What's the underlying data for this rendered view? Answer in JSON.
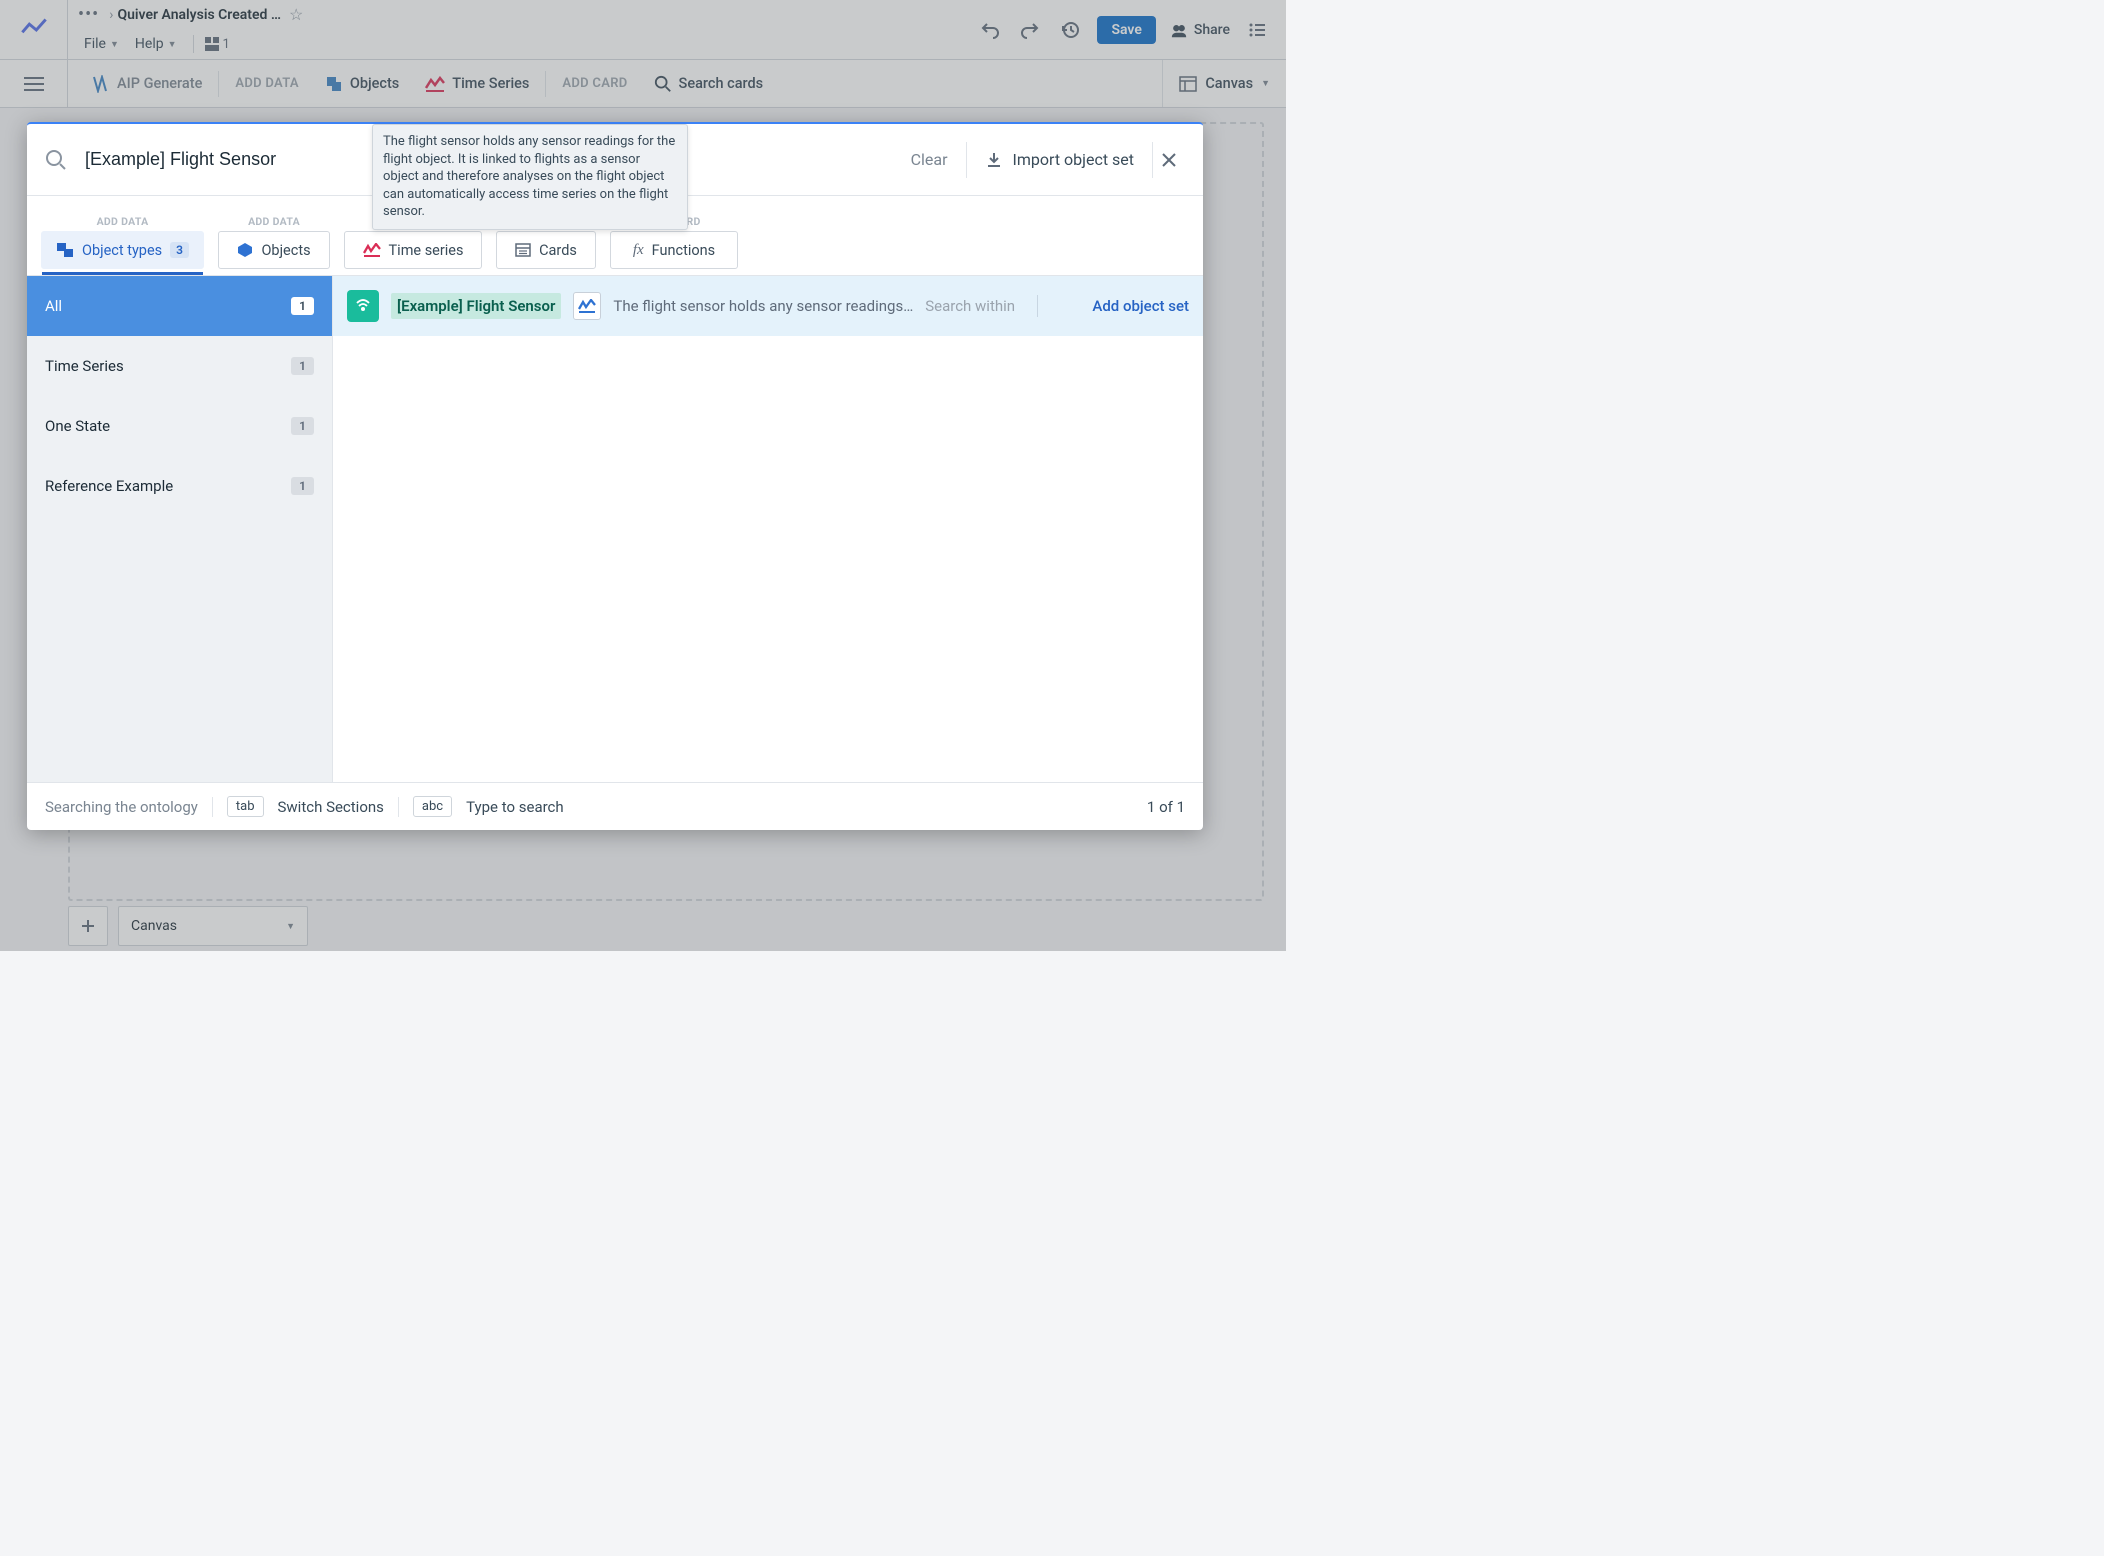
{
  "header": {
    "breadcrumb_title": "Quiver Analysis Created …",
    "file_label": "File",
    "help_label": "Help",
    "dash_count": "1",
    "save_label": "Save",
    "share_label": "Share"
  },
  "toolbar": {
    "aip_generate": "AIP Generate",
    "add_data": "ADD DATA",
    "objects": "Objects",
    "time_series": "Time Series",
    "add_card": "ADD CARD",
    "search_cards": "Search cards",
    "canvas": "Canvas"
  },
  "bottom": {
    "canvas_label": "Canvas"
  },
  "modal": {
    "search_value": "[Example] Flight Sensor",
    "clear": "Clear",
    "import": "Import object set"
  },
  "tabs": {
    "caption_add_data": "ADD DATA",
    "caption_add_card": "ADD CARD",
    "object_types": "Object types",
    "object_types_count": "3",
    "objects": "Objects",
    "time_series": "Time series",
    "cards": "Cards",
    "functions": "Functions"
  },
  "sidebar": [
    {
      "label": "All",
      "count": "1"
    },
    {
      "label": "Time Series",
      "count": "1"
    },
    {
      "label": "One State",
      "count": "1"
    },
    {
      "label": "Reference Example",
      "count": "1"
    }
  ],
  "result": {
    "title": "[Example] Flight Sensor",
    "desc": "The flight sensor holds any sensor readings…",
    "search_within": "Search within",
    "add_object_set": "Add object set"
  },
  "footer": {
    "searching": "Searching the ontology",
    "tab_key": "tab",
    "switch_sections": "Switch Sections",
    "abc_key": "abc",
    "type_to_search": "Type to search",
    "counter": "1 of 1"
  },
  "tooltip": "The flight sensor holds any sensor readings for the flight object. It is linked to flights as a sensor object and therefore analyses on the flight object can automatically access time series on the flight sensor."
}
